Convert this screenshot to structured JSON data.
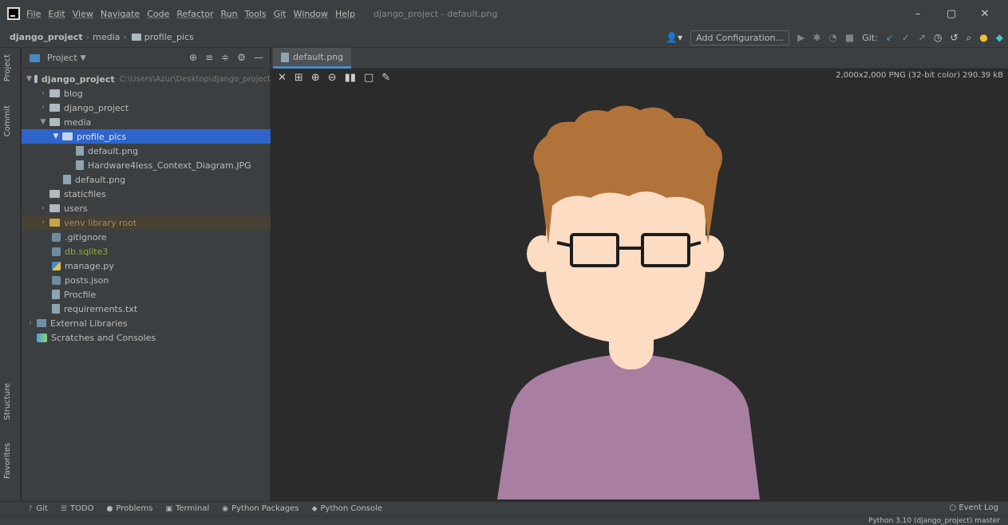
{
  "menu": {
    "items": [
      "File",
      "Edit",
      "View",
      "Navigate",
      "Code",
      "Refactor",
      "Run",
      "Tools",
      "Git",
      "Window",
      "Help"
    ],
    "window_title": "django_project - default.png"
  },
  "window_controls": [
    "–",
    "▢",
    "✕"
  ],
  "breadcrumb": {
    "project": "django_project",
    "folder": "media",
    "current": "profile_pics"
  },
  "toolbar": {
    "add_configuration": "Add Configuration...",
    "git_label": "Git:"
  },
  "left_strip": {
    "project_tab": "Project",
    "commit_tab": "Commit",
    "structure_tab": "Structure",
    "favorites_tab": "Favorites"
  },
  "project_panel": {
    "title": "Project",
    "tree": [
      {
        "label": "django_project",
        "path_hint": "C:\\Users\\Azur\\Desktop\\django_project"
      },
      {
        "label": "blog"
      },
      {
        "label": "django_project"
      },
      {
        "label": "media"
      },
      {
        "label": "profile_pics"
      },
      {
        "label": "default.png"
      },
      {
        "label": "Hardware4less_Context_Diagram.JPG"
      },
      {
        "label": "default.png"
      },
      {
        "label": "staticfiles"
      },
      {
        "label": "users"
      },
      {
        "label": "venv library root"
      },
      {
        "label": ".gitignore"
      },
      {
        "label": "db.sqlite3"
      },
      {
        "label": "manage.py"
      },
      {
        "label": "posts.json"
      },
      {
        "label": "Procfile"
      },
      {
        "label": "requirements.txt"
      },
      {
        "label": "External Libraries"
      },
      {
        "label": "Scratches and Consoles"
      }
    ]
  },
  "editor": {
    "tab_label": "default.png",
    "image_info": "2,000x2,000 PNG (32-bit color) 290.39 kB"
  },
  "bottom_tools": {
    "git": "Git",
    "todo": "TODO",
    "problems": "Problems",
    "terminal": "Terminal",
    "python_packages": "Python Packages",
    "python_console": "Python Console",
    "event_log": "Event Log"
  },
  "status_bar": {
    "text": "Python 3.10 (django_project)   master"
  },
  "colors": {
    "hair": "#b2733a",
    "skin": "#fcdcc3",
    "shirt": "#a87ea1",
    "background": "#2b2b2b"
  }
}
